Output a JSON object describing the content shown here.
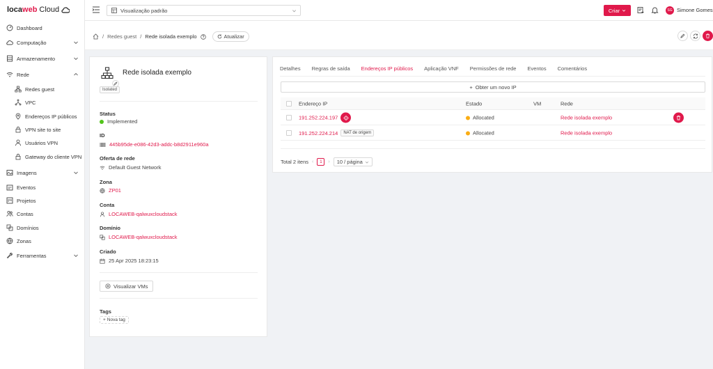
{
  "brand": {
    "part1": "loca",
    "part2": "web",
    "part3": "Cloud"
  },
  "sidebar": {
    "items": [
      {
        "label": "Dashboard",
        "icon": "dashboard-icon"
      },
      {
        "label": "Computação",
        "icon": "cloud-icon"
      },
      {
        "label": "Armazenamento",
        "icon": "storage-icon"
      },
      {
        "label": "Rede",
        "icon": "wifi-icon"
      },
      {
        "label": "Redes guest",
        "icon": "network-icon"
      },
      {
        "label": "VPC",
        "icon": "vpc-icon"
      },
      {
        "label": "Endereços IP públicos",
        "icon": "location-icon"
      },
      {
        "label": "VPN site to site",
        "icon": "lock-icon"
      },
      {
        "label": "Usuários VPN",
        "icon": "user-icon"
      },
      {
        "label": "Gateway do cliente VPN",
        "icon": "lock-icon"
      },
      {
        "label": "Imagens",
        "icon": "image-icon"
      },
      {
        "label": "Eventos",
        "icon": "schedule-icon"
      },
      {
        "label": "Projetos",
        "icon": "project-icon"
      },
      {
        "label": "Contas",
        "icon": "team-icon"
      },
      {
        "label": "Domínios",
        "icon": "block-icon"
      },
      {
        "label": "Zonas",
        "icon": "globe-icon"
      },
      {
        "label": "Ferramentas",
        "icon": "tool-icon"
      }
    ]
  },
  "topbar": {
    "view_select": "Visualização padrão",
    "create_label": "Criar",
    "user_initials": "SG",
    "user_name": "Simone Gomes"
  },
  "breadcrumb": {
    "level1": "Redes guest",
    "level2": "Rede isolada exemplo",
    "refresh_label": "Atualizar"
  },
  "details": {
    "title": "Rede isolada exemplo",
    "type_tag": "Isolated",
    "status_label": "Status",
    "status_value": "Implemented",
    "id_label": "ID",
    "id_value": "445b95de-e086-42d3-addc-b8d2911e960a",
    "offering_label": "Oferta de rede",
    "offering_value": "Default Guest Network",
    "zone_label": "Zona",
    "zone_value": "ZP01",
    "account_label": "Conta",
    "account_value": "LOCAWEB-qalwuxcloudstack",
    "domain_label": "Domínio",
    "domain_value": "LOCAWEB-qalwuxcloudstack",
    "created_label": "Criado",
    "created_value": "25 Apr 2025 18:23:15",
    "view_vms_label": "Visualizar VMs",
    "tags_label": "Tags",
    "new_tag_label": "Nova tag"
  },
  "tabs": [
    {
      "label": "Detalhes"
    },
    {
      "label": "Regras de saída"
    },
    {
      "label": "Endereços IP públicos"
    },
    {
      "label": "Aplicação VNF"
    },
    {
      "label": "Permissões de rede"
    },
    {
      "label": "Eventos"
    },
    {
      "label": "Comentários"
    }
  ],
  "ip_panel": {
    "get_ip_label": "Obter um novo IP",
    "columns": {
      "ip": "Endereço IP",
      "state": "Estado",
      "vm": "VM",
      "network": "Rede"
    },
    "rows": [
      {
        "ip": "191.252.224.197",
        "tag": "",
        "state": "Allocated",
        "vm": "",
        "network": "Rede isolada exemplo"
      },
      {
        "ip": "191.252.224.214",
        "tag": "NAT de origem",
        "state": "Allocated",
        "vm": "",
        "network": "Rede isolada exemplo"
      }
    ],
    "total_label": "Total 2 itens",
    "page": "1",
    "page_size": "10 / página"
  },
  "colors": {
    "accent": "#e0194b",
    "status_ok": "#52c41a",
    "status_allocated": "#faad14"
  }
}
